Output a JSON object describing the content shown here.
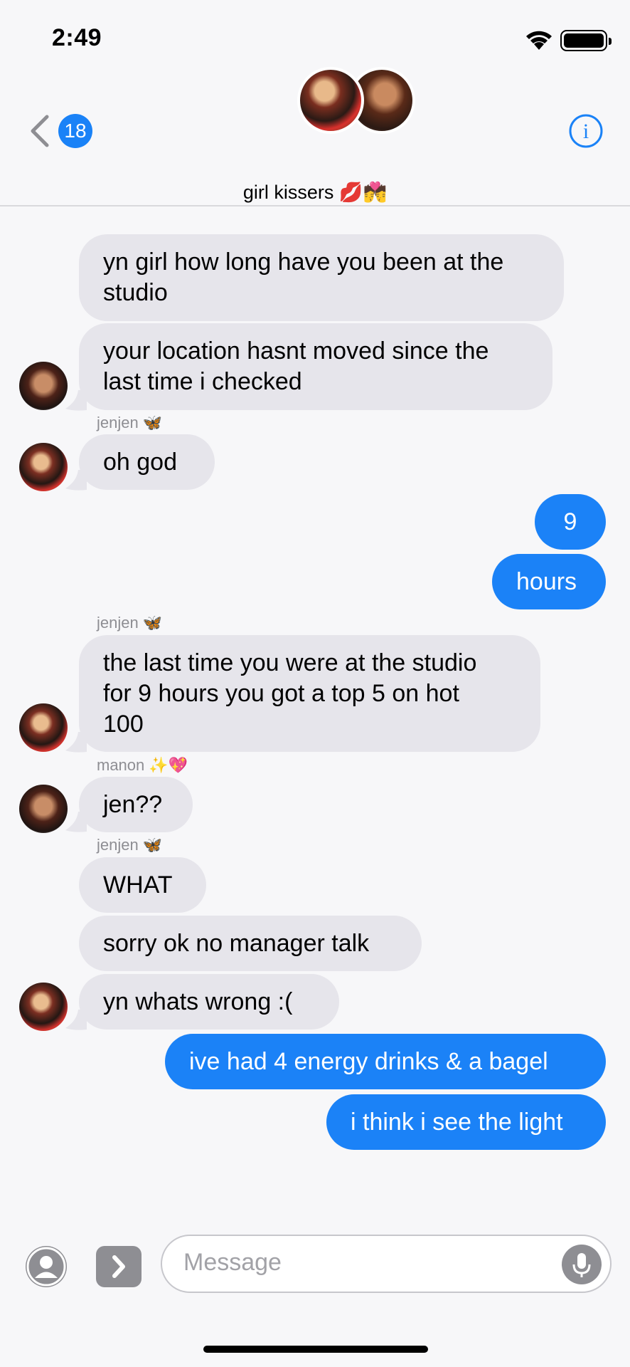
{
  "status": {
    "time": "2:49"
  },
  "nav": {
    "back_count": "18",
    "group_name": "girl kissers 💋💏"
  },
  "messages": [
    {
      "text": "yn girl how long have you been at the\nstudio"
    },
    {
      "text": "your location hasnt moved since the\nlast time i checked"
    },
    {
      "sender": "jenjen 🦋"
    },
    {
      "text": "oh god"
    },
    {
      "text": "9"
    },
    {
      "text": "hours"
    },
    {
      "sender": "jenjen 🦋"
    },
    {
      "text": "the last time you were at the studio\nfor 9 hours you got a top 5 on hot\n100"
    },
    {
      "sender": "manon ✨💖"
    },
    {
      "text": "jen??"
    },
    {
      "sender": "jenjen 🦋"
    },
    {
      "text": "WHAT"
    },
    {
      "text": "sorry ok no manager talk"
    },
    {
      "text": "yn whats wrong :("
    },
    {
      "text": "ive had 4 energy drinks & a bagel"
    },
    {
      "text": "i think i see the light"
    }
  ],
  "input": {
    "placeholder": "Message"
  },
  "colors": {
    "sent": "#1b82f7",
    "received": "#e6e5eb",
    "accent": "#1a82f7"
  }
}
